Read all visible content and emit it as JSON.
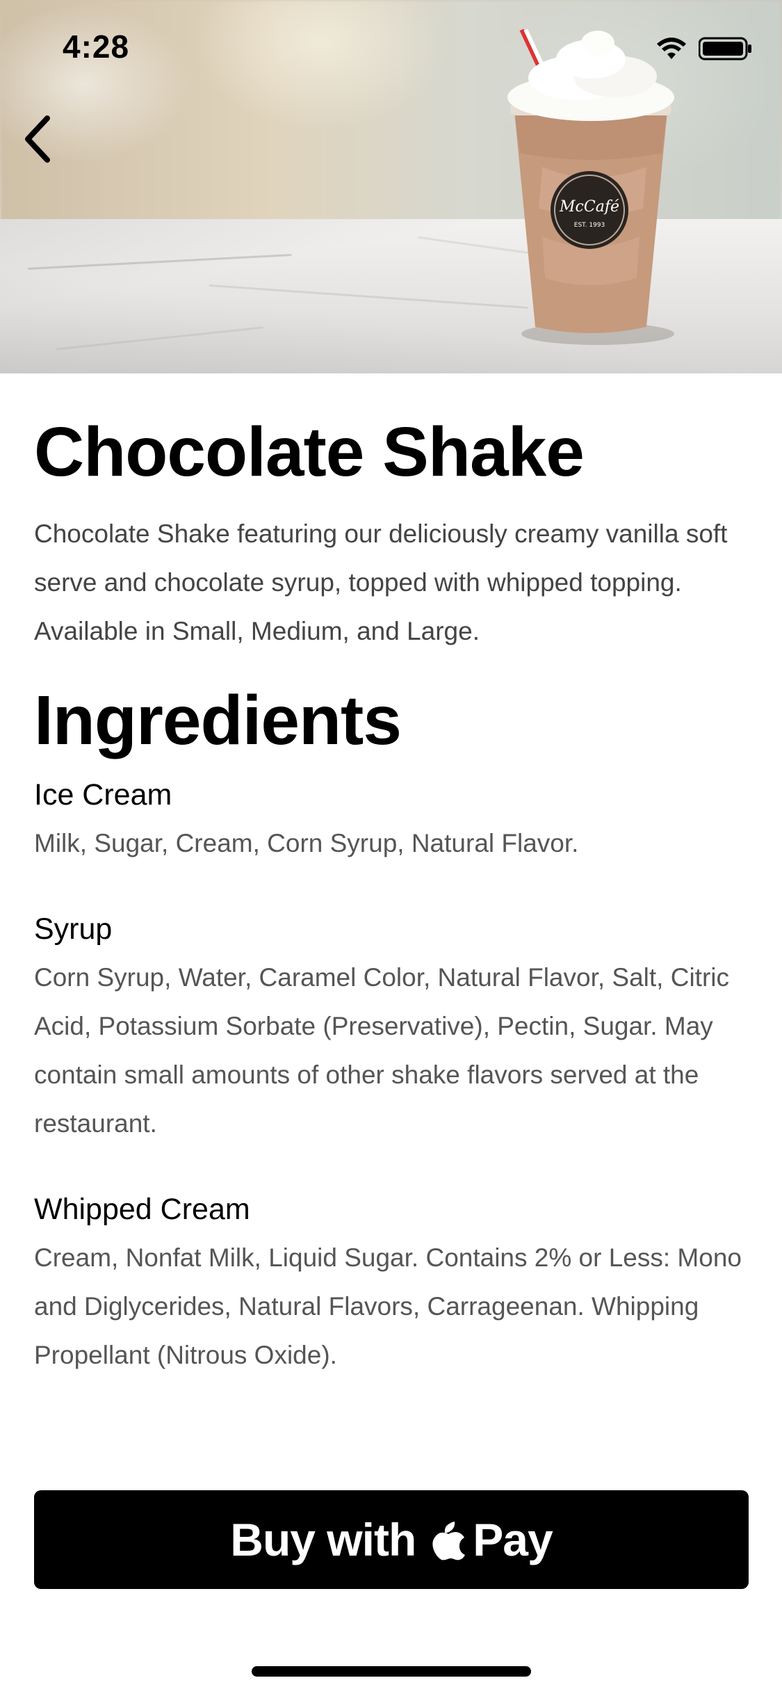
{
  "status_bar": {
    "time": "4:28",
    "icons": [
      "wifi-icon",
      "battery-icon"
    ]
  },
  "header": {
    "back_icon": "chevron-left-icon",
    "product_image": "chocolate-shake-photo",
    "cup_logo_text": "McCafé",
    "cup_logo_subtext": "EST. 1993"
  },
  "product": {
    "title": "Chocolate Shake",
    "description": "Chocolate Shake featuring our deliciously creamy vanilla soft serve and chocolate syrup, topped with whipped topping. Available in Small, Medium, and Large."
  },
  "ingredients": {
    "heading": "Ingredients",
    "items": [
      {
        "name": "Ice Cream",
        "text": "Milk, Sugar, Cream, Corn Syrup, Natural Flavor."
      },
      {
        "name": "Syrup",
        "text": "Corn Syrup, Water, Caramel Color, Natural Flavor, Salt, Citric Acid, Potassium Sorbate (Preservative), Pectin, Sugar. May contain small amounts of other shake flavors served at the restaurant."
      },
      {
        "name": "Whipped Cream",
        "text": "Cream, Nonfat Milk, Liquid Sugar. Contains 2% or Less: Mono and Diglycerides, Natural Flavors, Carrageenan. Whipping Propellant (Nitrous Oxide)."
      }
    ]
  },
  "buy_button": {
    "label_prefix": "Buy with",
    "label_suffix": "Pay",
    "icon": "apple-logo-icon",
    "background": "#000000",
    "text_color": "#ffffff"
  }
}
